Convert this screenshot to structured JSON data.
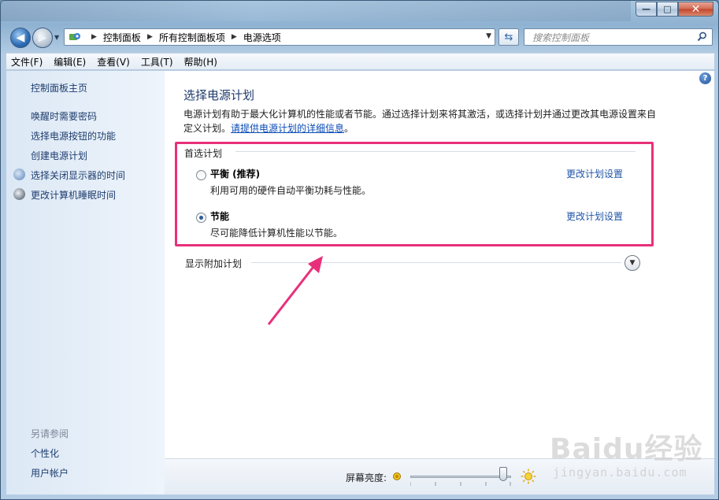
{
  "window": {
    "caption": {
      "minimize": "—",
      "maximize": "□",
      "close": "✕"
    }
  },
  "nav": {
    "breadcrumb": [
      "控制面板",
      "所有控制面板项",
      "电源选项"
    ],
    "search_placeholder": "搜索控制面板"
  },
  "menubar": {
    "items": [
      "文件(F)",
      "编辑(E)",
      "查看(V)",
      "工具(T)",
      "帮助(H)"
    ]
  },
  "sidebar": {
    "home": "控制面板主页",
    "links": [
      "唤醒时需要密码",
      "选择电源按钮的功能",
      "创建电源计划",
      "选择关闭显示器的时间",
      "更改计算机睡眠时间"
    ],
    "see_also_heading": "另请参阅",
    "see_also": [
      "个性化",
      "用户帐户"
    ]
  },
  "main": {
    "help": "?",
    "title": "选择电源计划",
    "description": "电源计划有助于最大化计算机的性能或者节能。通过选择计划来将其激活，或选择计划并通过更改其电源设置来自定义计划。",
    "description_link": "请提供电源计划的详细信息",
    "description_end": "。",
    "preferred_heading": "首选计划",
    "plans": [
      {
        "name": "平衡 (推荐)",
        "desc": "利用可用的硬件自动平衡功耗与性能。",
        "link": "更改计划设置",
        "selected": false
      },
      {
        "name": "节能",
        "desc": "尽可能降低计算机性能以节能。",
        "link": "更改计划设置",
        "selected": true
      }
    ],
    "show_more": "显示附加计划"
  },
  "footer": {
    "brightness_label": "屏幕亮度:",
    "brightness_level_percent": 92
  },
  "watermark": {
    "top": "Baidu经验",
    "bottom": "jingyan.baidu.com"
  },
  "colors": {
    "highlight": "#e8307a",
    "link": "#1f55a8",
    "title": "#1e3a6a"
  }
}
